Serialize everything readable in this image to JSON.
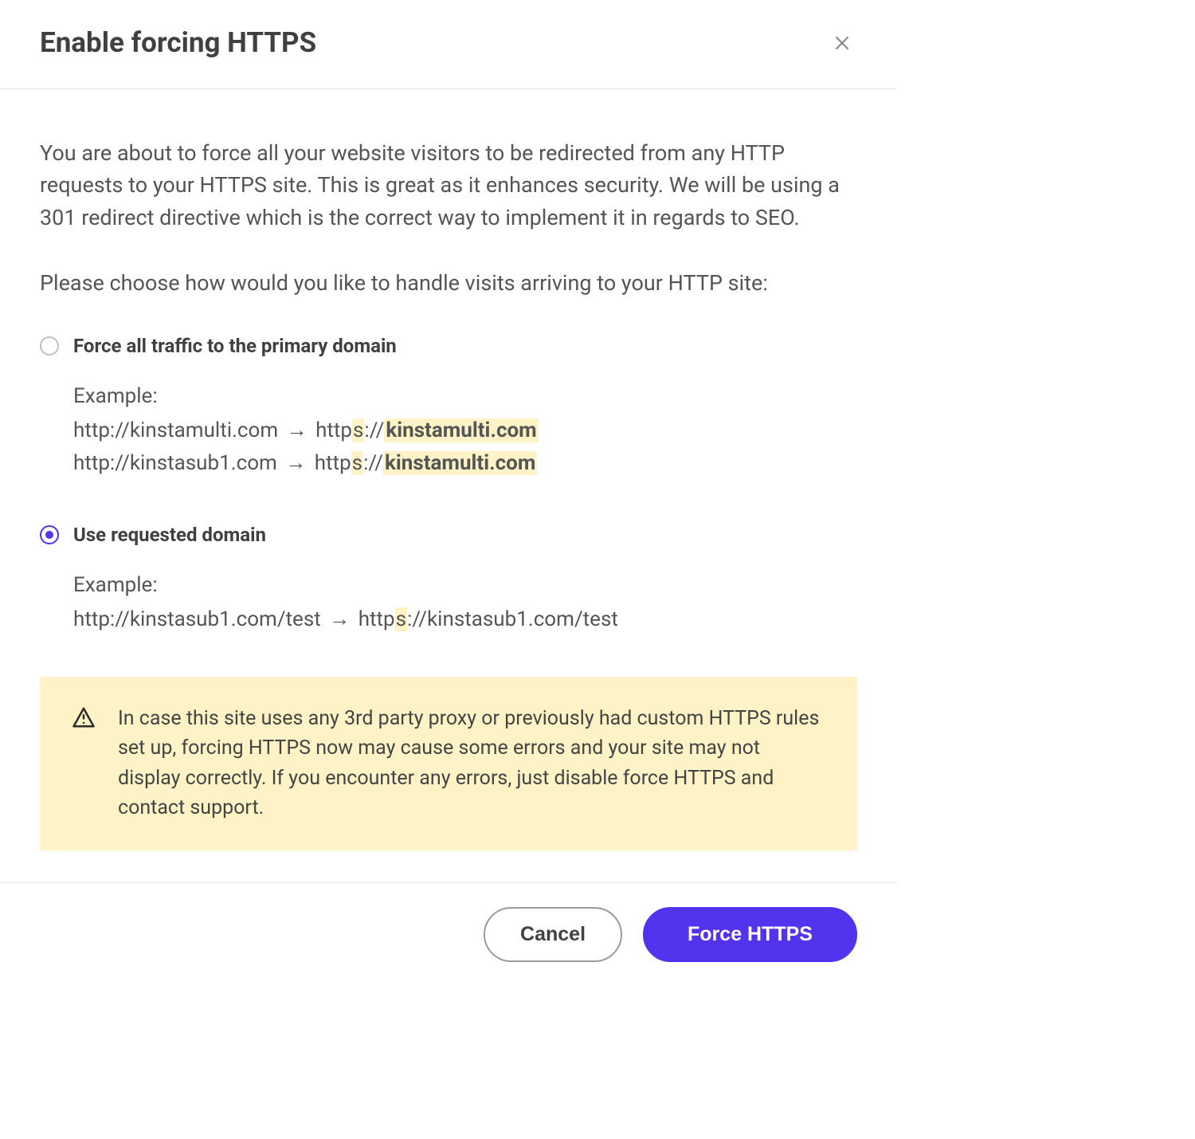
{
  "header": {
    "title": "Enable forcing HTTPS"
  },
  "intro": "You are about to force all your website visitors to be redirected from any HTTP requests to your HTTPS site. This is great as it enhances security. We will be using a 301 redirect directive which is the correct way to implement it in regards to SEO.",
  "prompt": "Please choose how would you like to handle visits arriving to your HTTP site:",
  "options": {
    "primary": {
      "label": "Force all traffic to the primary domain",
      "selected": false,
      "example_label": "Example:",
      "lines": [
        {
          "from": "http://kinstamulti.com",
          "to_prefix": "http",
          "to_s": "s",
          "to_sep": "://",
          "to_highlight": "kinstamulti.com"
        },
        {
          "from": "http://kinstasub1.com",
          "to_prefix": "http",
          "to_s": "s",
          "to_sep": "://",
          "to_highlight": "kinstamulti.com"
        }
      ]
    },
    "requested": {
      "label": "Use requested domain",
      "selected": true,
      "example_label": "Example:",
      "line": {
        "from": "http://kinstasub1.com/test",
        "to_prefix": "http",
        "to_s": "s",
        "to_rest": "://kinstasub1.com/test"
      }
    }
  },
  "arrow_glyph": "→",
  "warning": "In case this site uses any 3rd party proxy or previously had custom HTTPS rules set up, forcing HTTPS now may cause some errors and your site may not display correctly. If you encounter any errors, just disable force HTTPS and contact support.",
  "footer": {
    "cancel": "Cancel",
    "confirm": "Force HTTPS"
  },
  "colors": {
    "accent": "#5333ed",
    "highlight": "#fdf3c7"
  }
}
